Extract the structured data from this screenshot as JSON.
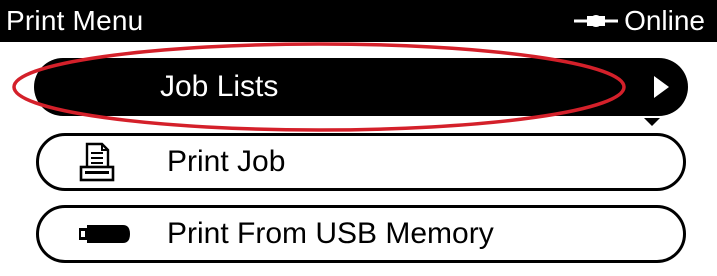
{
  "header": {
    "title": "Print Menu",
    "status_label": "Online",
    "status_icon": "connection-plug-icon"
  },
  "menu": {
    "items": [
      {
        "label": "Job Lists",
        "icon": "chevron-right-icon",
        "selected": true
      },
      {
        "label": "Print Job",
        "icon": "document-printer-icon",
        "selected": false
      },
      {
        "label": "Print From USB Memory",
        "icon": "usb-memory-icon",
        "selected": false
      }
    ],
    "scroll_indicator": "scroll-down-icon"
  },
  "colors": {
    "background": "#ffffff",
    "title_bar": "#000000",
    "selection": "#000000",
    "annotation_ring": "#d4202a"
  }
}
